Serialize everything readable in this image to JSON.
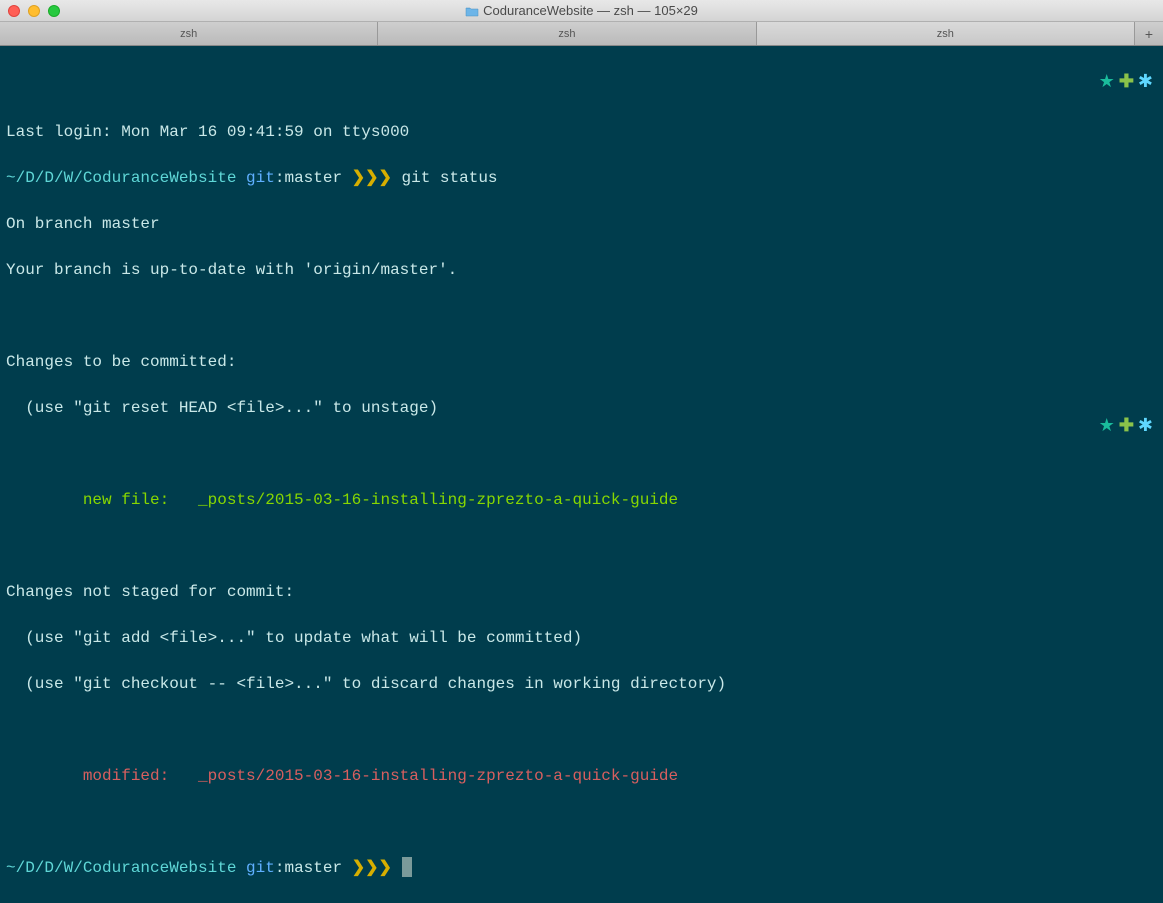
{
  "window": {
    "title": "CoduranceWebsite — zsh — 105×29"
  },
  "tabs": [
    {
      "label": "zsh",
      "active": false
    },
    {
      "label": "zsh",
      "active": false
    },
    {
      "label": "zsh",
      "active": true
    }
  ],
  "lastLogin": "Last login: Mon Mar 16 09:41:59 on ttys000",
  "prompt": {
    "path": "~/D/D/W/CoduranceWebsite",
    "gitLabel": "git",
    "colon": ":",
    "branch": "master",
    "arrows": "❯❯❯",
    "command": "git status"
  },
  "output": {
    "branchLine": "On branch master",
    "upToDate": "Your branch is up-to-date with 'origin/master'.",
    "changesHeader": "Changes to be committed:",
    "unstageHint": "  (use \"git reset HEAD <file>...\" to unstage)",
    "newFileLabel": "        new file:   ",
    "newFilePath": "_posts/2015-03-16-installing-zprezto-a-quick-guide",
    "notStagedHeader": "Changes not staged for commit:",
    "addHint": "  (use \"git add <file>...\" to update what will be committed)",
    "checkoutHint": "  (use \"git checkout -- <file>...\" to discard changes in working directory)",
    "modifiedLabel": "        modified:   ",
    "modifiedPath": "_posts/2015-03-16-installing-zprezto-a-quick-guide"
  },
  "indicators": {
    "star": "★",
    "plus": "✚",
    "asterisk": "✱"
  }
}
